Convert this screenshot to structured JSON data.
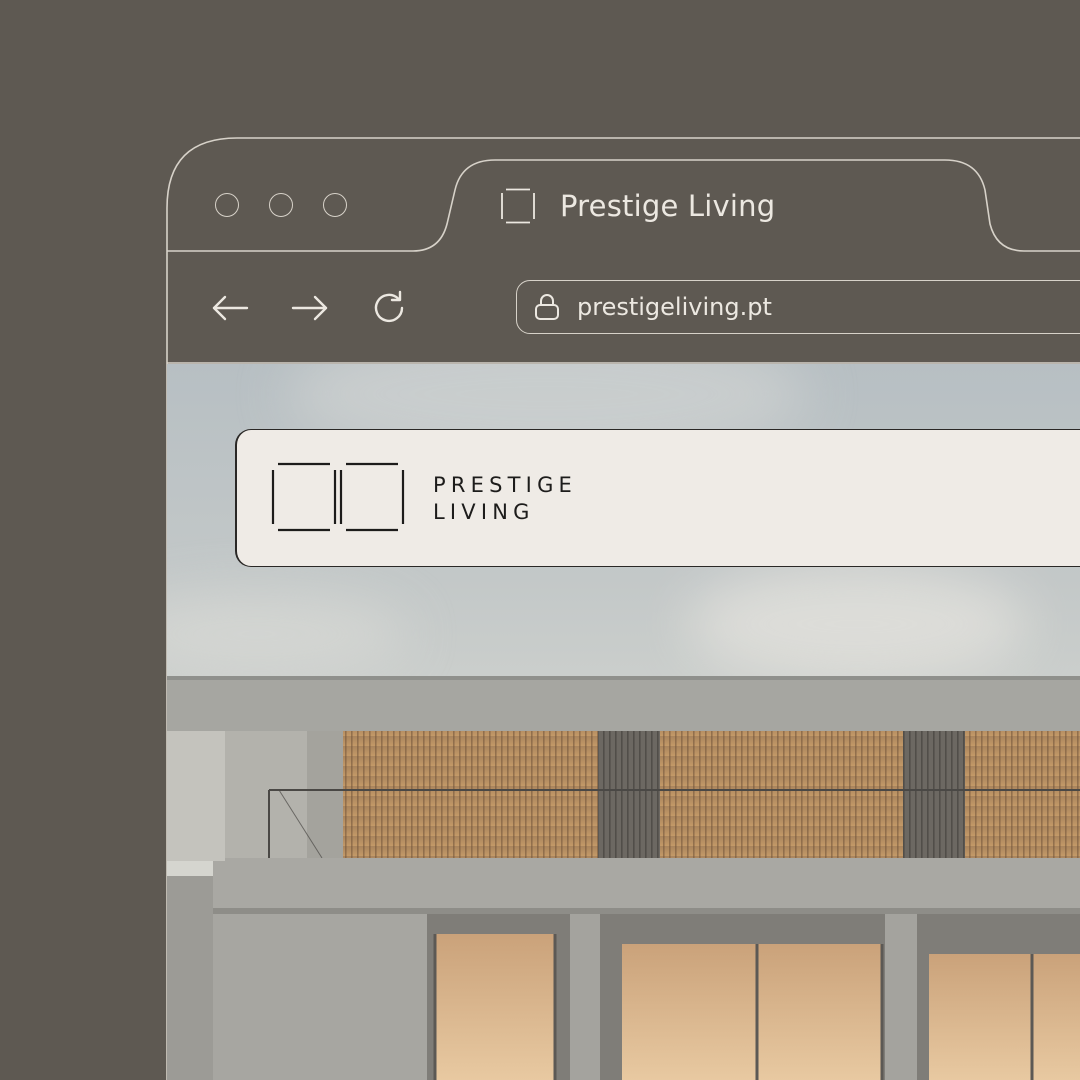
{
  "browser": {
    "tab": {
      "title": "Prestige Living",
      "icon": "square-favicon-icon"
    },
    "nav": {
      "back_icon": "arrow-left-icon",
      "forward_icon": "arrow-right-icon",
      "reload_icon": "reload-icon"
    },
    "address_bar": {
      "url": "prestigeliving.pt",
      "icon": "lock-icon"
    },
    "window_controls": [
      "window-dot-icon",
      "window-dot-icon",
      "window-dot-icon"
    ]
  },
  "site": {
    "header": {
      "brand_line1": "PRESTIGE",
      "brand_line2": "LIVING",
      "logo_icon": "double-square-logo-icon"
    },
    "hero_image": "modern-apartment-building"
  },
  "colors": {
    "background": "#5e5952",
    "chrome_stroke": "#d7d2c9",
    "chrome_text": "#ece8e1",
    "header_bg": "#efebe6",
    "brand_text": "#1d1c1b"
  }
}
